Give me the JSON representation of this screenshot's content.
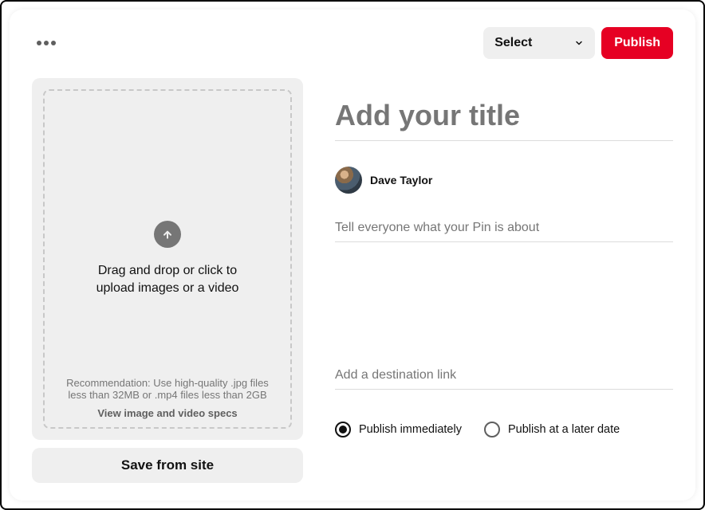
{
  "topbar": {
    "select_label": "Select",
    "publish_label": "Publish"
  },
  "upload": {
    "dragdrop_text": "Drag and drop or click to upload images or a video",
    "recommendation": "Recommendation: Use high-quality .jpg files less than 32MB or .mp4 files less than 2GB",
    "specs_link_label": "View image and video specs",
    "save_from_site_label": "Save from site"
  },
  "form": {
    "title_placeholder": "Add your title",
    "title_value": "",
    "user_name": "Dave Taylor",
    "description_placeholder": "Tell everyone what your Pin is about",
    "description_value": "",
    "link_placeholder": "Add a destination link",
    "link_value": ""
  },
  "schedule": {
    "immediate_label": "Publish immediately",
    "later_label": "Publish at a later date",
    "selected": "immediate"
  }
}
